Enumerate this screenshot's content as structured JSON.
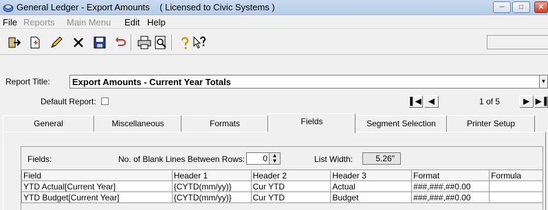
{
  "window": {
    "title": "General Ledger - Export Amounts    ( Licensed to Civic Systems )",
    "icons": {
      "app": "app-icon",
      "minimize": "minimize-icon",
      "maximize": "maximize-icon",
      "close": "close-icon"
    }
  },
  "menu": {
    "items": [
      {
        "label": "File",
        "enabled": true
      },
      {
        "label": "Reports",
        "enabled": false
      },
      {
        "label": "Main Menu",
        "enabled": false
      },
      {
        "label": "Edit",
        "enabled": true
      },
      {
        "label": "Help",
        "enabled": true
      }
    ]
  },
  "toolbar": {
    "buttons": [
      "exit-icon",
      "new-icon",
      "edit-pencil-icon",
      "delete-icon",
      "save-icon",
      "undo-icon",
      "print-icon",
      "print-preview-icon",
      "help-icon",
      "context-help-icon"
    ]
  },
  "report": {
    "title_label": "Report Title:",
    "title_value": "Export Amounts - Current Year Totals",
    "default_label": "Default Report:",
    "default_checked": false,
    "navigator": {
      "position": "1 of 5"
    }
  },
  "tabs": {
    "items": [
      "General",
      "Miscellaneous",
      "Formats",
      "Fields",
      "Segment Selection",
      "Printer Setup"
    ],
    "active": "Fields"
  },
  "fields_panel": {
    "fields_label": "Fields:",
    "blank_lines_label": "No. of Blank Lines Between Rows:",
    "blank_lines_value": "0",
    "list_width_label": "List Width:",
    "list_width_value": "5.26\"",
    "columns": [
      "Field",
      "Header 1",
      "Header 2",
      "Header 3",
      "Format",
      "Formula"
    ],
    "rows": [
      [
        "YTD Actual[Current Year]",
        "{CYTD(mm/yy)}",
        "Cur YTD",
        "Actual",
        "###,###,##0.00",
        ""
      ],
      [
        "YTD Budget[Current Year]",
        "{CYTD(mm/yy)}",
        "Cur YTD",
        "Budget",
        "###,###,##0.00",
        ""
      ]
    ]
  }
}
